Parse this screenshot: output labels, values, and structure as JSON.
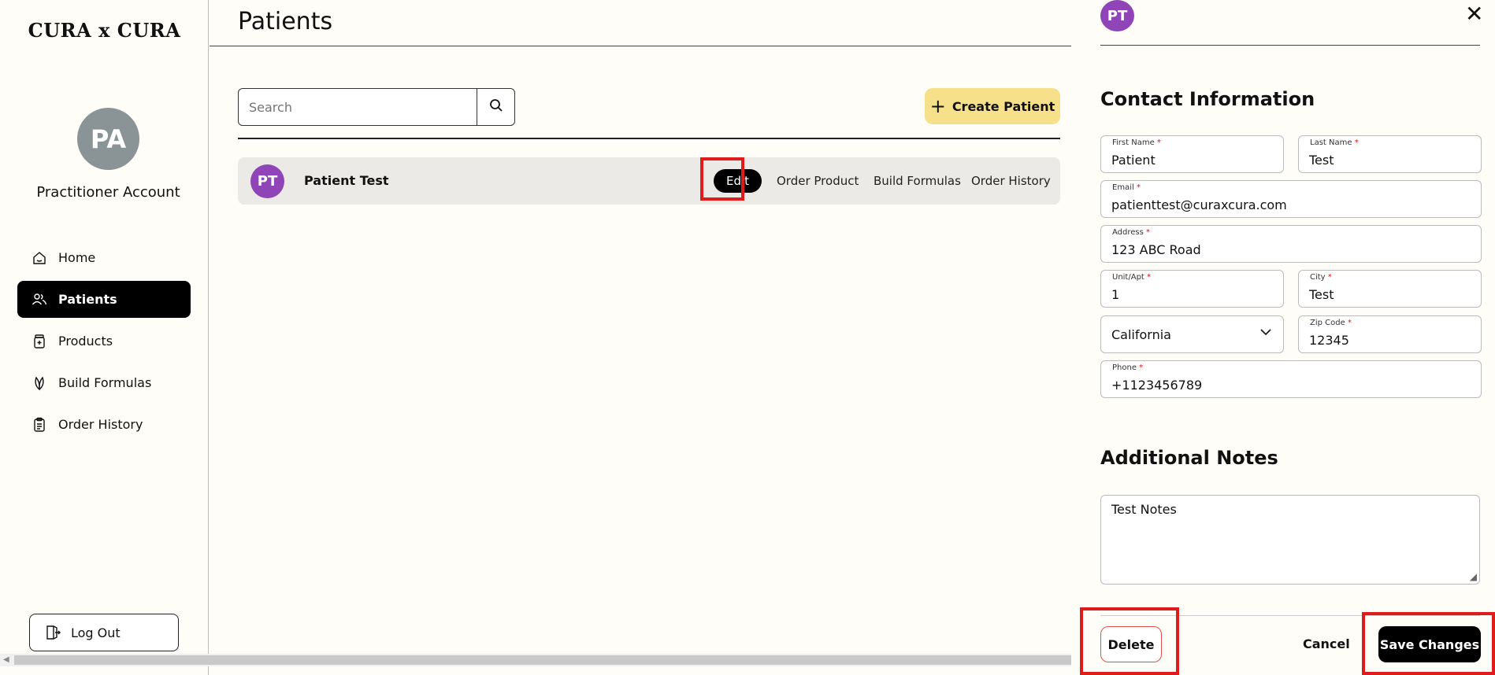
{
  "sidebar": {
    "logo": "CURA x CURA",
    "avatar_initials": "PA",
    "account_name": "Practitioner Account",
    "nav": [
      {
        "label": "Home",
        "icon": "home-icon",
        "active": false
      },
      {
        "label": "Patients",
        "icon": "users-icon",
        "active": true
      },
      {
        "label": "Products",
        "icon": "jar-icon",
        "active": false
      },
      {
        "label": "Build Formulas",
        "icon": "leaf-icon",
        "active": false
      },
      {
        "label": "Order History",
        "icon": "clipboard-icon",
        "active": false
      }
    ],
    "logout_label": "Log Out"
  },
  "main": {
    "title": "Patients",
    "search": {
      "placeholder": "Search",
      "value": ""
    },
    "create_label": "Create Patient",
    "patients": [
      {
        "initials": "PT",
        "name": "Patient Test",
        "edit_label": "Edit",
        "order_product_label": "Order Product",
        "build_formulas_label": "Build Formulas",
        "order_history_label": "Order History"
      }
    ]
  },
  "panel": {
    "avatar_initials": "PT",
    "close_glyph": "✕",
    "contact_title": "Contact Information",
    "fields": {
      "first_name": {
        "label": "First Name",
        "value": "Patient"
      },
      "last_name": {
        "label": "Last Name",
        "value": "Test"
      },
      "email": {
        "label": "Email",
        "value": "patienttest@curaxcura.com"
      },
      "address": {
        "label": "Address",
        "value": "123 ABC Road"
      },
      "unit": {
        "label": "Unit/Apt",
        "value": "1"
      },
      "city": {
        "label": "City",
        "value": "Test"
      },
      "state": {
        "value": "California"
      },
      "zip": {
        "label": "Zip Code",
        "value": "12345"
      },
      "phone": {
        "label": "Phone",
        "value": "+1123456789"
      }
    },
    "required_mark": "*",
    "notes_title": "Additional Notes",
    "notes_value": "Test Notes",
    "delete_label": "Delete",
    "cancel_label": "Cancel",
    "save_label": "Save Changes"
  },
  "colors": {
    "background": "#fefdf7",
    "accent_yellow": "#f6e08a",
    "avatar_purple": "#8f44b8",
    "avatar_gray": "#8a9396",
    "highlight_red": "#e01b1b",
    "delete_border": "#e24c4c"
  }
}
